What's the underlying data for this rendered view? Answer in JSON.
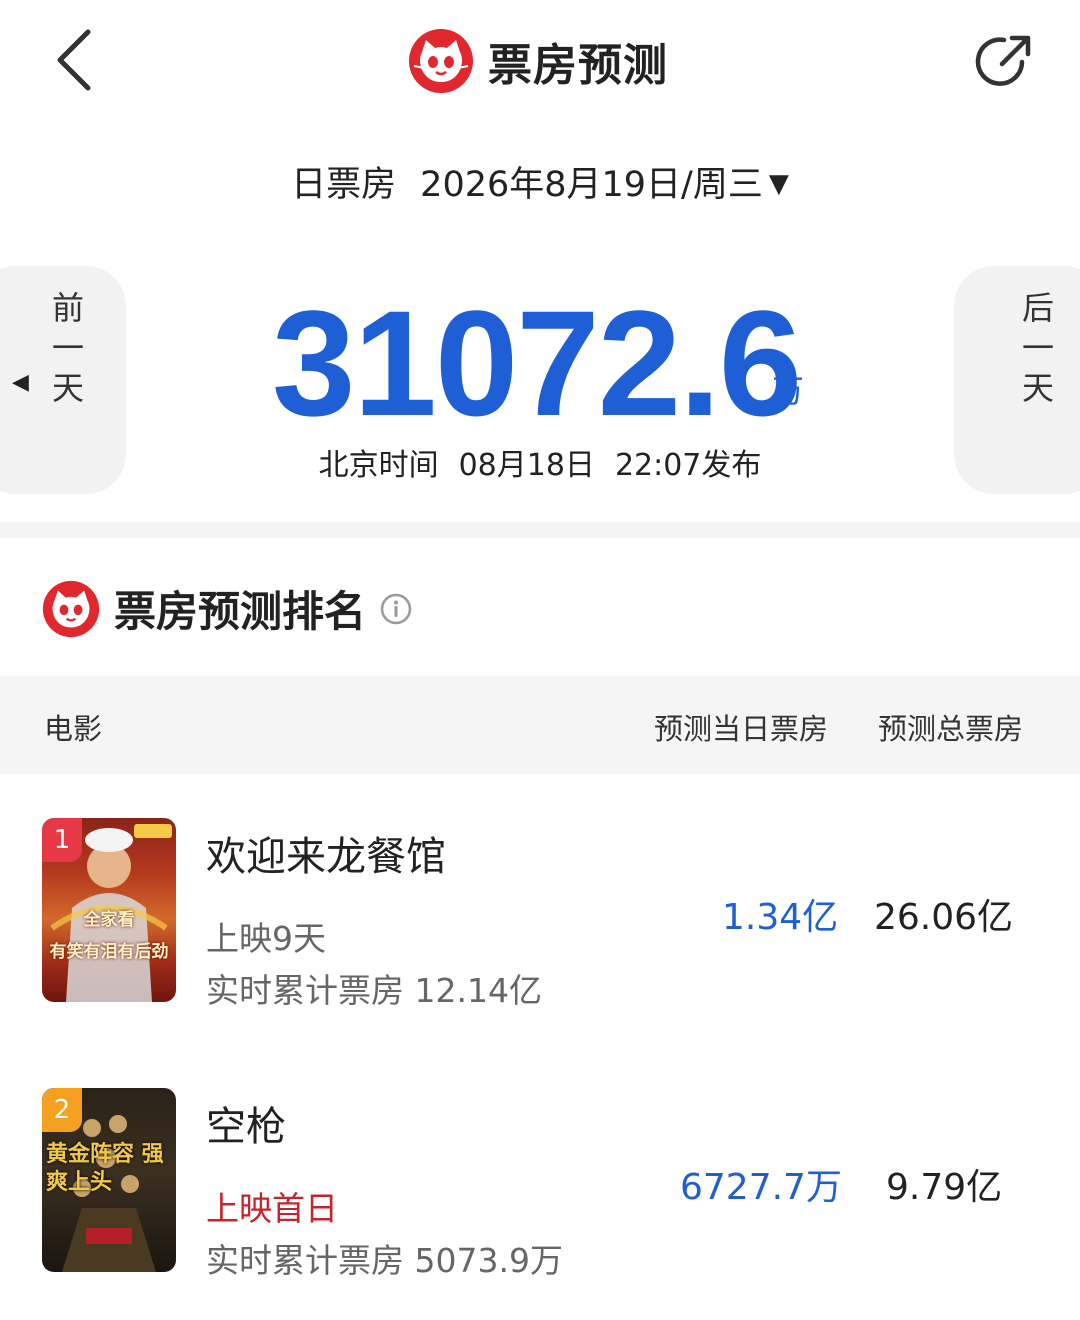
{
  "header": {
    "title": "票房预测",
    "back_icon": "chevron-left-icon",
    "share_icon": "share-arrow-icon",
    "logo_icon": "maoyan-cat-icon"
  },
  "date_selector": {
    "label": "日票房",
    "date": "2026年8月19日/周三",
    "caret": "▼"
  },
  "summary": {
    "prev_day_label": [
      "前",
      "一",
      "天"
    ],
    "next_day_label": [
      "后",
      "一",
      "天"
    ],
    "prev_arrow": "◀",
    "next_arrow": "▶",
    "total_value": "31072.6",
    "total_unit": "万",
    "publish_prefix": "北京时间",
    "publish_date": "08月18日",
    "publish_time": "22:07发布"
  },
  "ranking": {
    "title": "票房预测排名",
    "info_icon": "info-circle-icon",
    "columns": {
      "movie": "电影",
      "day_forecast": "预测当日票房",
      "total_forecast": "预测总票房"
    },
    "rows": [
      {
        "rank": "1",
        "name": "欢迎来龙餐馆",
        "days": "上映9天",
        "cumulative": "实时累计票房 12.14亿",
        "day_forecast": "1.34亿",
        "total_forecast": "26.06亿",
        "poster_text": "全家看\n有笑有泪有后劲"
      },
      {
        "rank": "2",
        "name": "空枪",
        "days": "上映首日",
        "cumulative": "实时累计票房 5073.9万",
        "day_forecast": "6727.7万",
        "total_forecast": "9.79亿",
        "poster_text": "黄金阵容 强爽上头"
      }
    ]
  },
  "colors": {
    "accent_blue": "#1f5fd6",
    "brand_red": "#e0282e",
    "first_day_red": "#c8232c",
    "rank1_badge": "#e63946",
    "rank2_badge": "#f4a020"
  }
}
